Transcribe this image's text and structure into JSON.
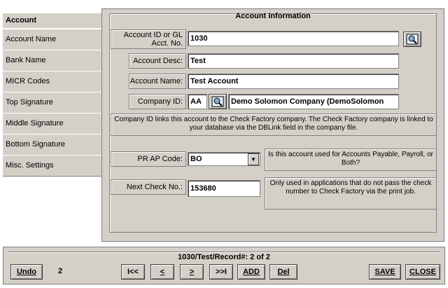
{
  "tabs": [
    {
      "label": "Account"
    },
    {
      "label": "Account Name"
    },
    {
      "label": "Bank Name"
    },
    {
      "label": "MICR Codes"
    },
    {
      "label": "Top Signature"
    },
    {
      "label": "Middle Signature"
    },
    {
      "label": "Bottom Signature"
    },
    {
      "label": "Misc. Settings"
    }
  ],
  "panel": {
    "title": "Account Information"
  },
  "fields": {
    "account_id": {
      "label_line1": "Account ID or GL",
      "label_line2": "Acct. No.",
      "value": "1030"
    },
    "account_desc": {
      "label": "Account Desc:",
      "value": "Test"
    },
    "account_name": {
      "label": "Account Name:",
      "value": "Test Account"
    },
    "company_id": {
      "label": "Company ID:",
      "value": "AA",
      "company_name": "Demo Solomon Company (DemoSolomon"
    },
    "pr_ap_code": {
      "label": "PR AP Code:",
      "value": "BO"
    },
    "next_check": {
      "label": "Next Check No.:",
      "value": "153680"
    }
  },
  "notes": {
    "company_link": "Company ID links this account to the Check Factory company. The Check Factory company is linked to your database via the DBLink field in the company file.",
    "pr_ap": "Is this account used for Accounts Payable, Payroll, or Both?",
    "next_check": "Only used in applications that do not pass the check number to Check Factory via the print job."
  },
  "footer": {
    "record_text": "1030/Test/Record#:  2 of  2",
    "count": "2",
    "buttons": {
      "undo": "Undo",
      "first": "I<<",
      "prev": "<",
      "next": ">",
      "last": ">>I",
      "add": "ADD",
      "del": "Del",
      "save": "SAVE",
      "close": "CLOSE"
    }
  },
  "icons": {
    "lookup": "magnifier-lookup-icon",
    "dropdown": "triangle-down-icon"
  }
}
